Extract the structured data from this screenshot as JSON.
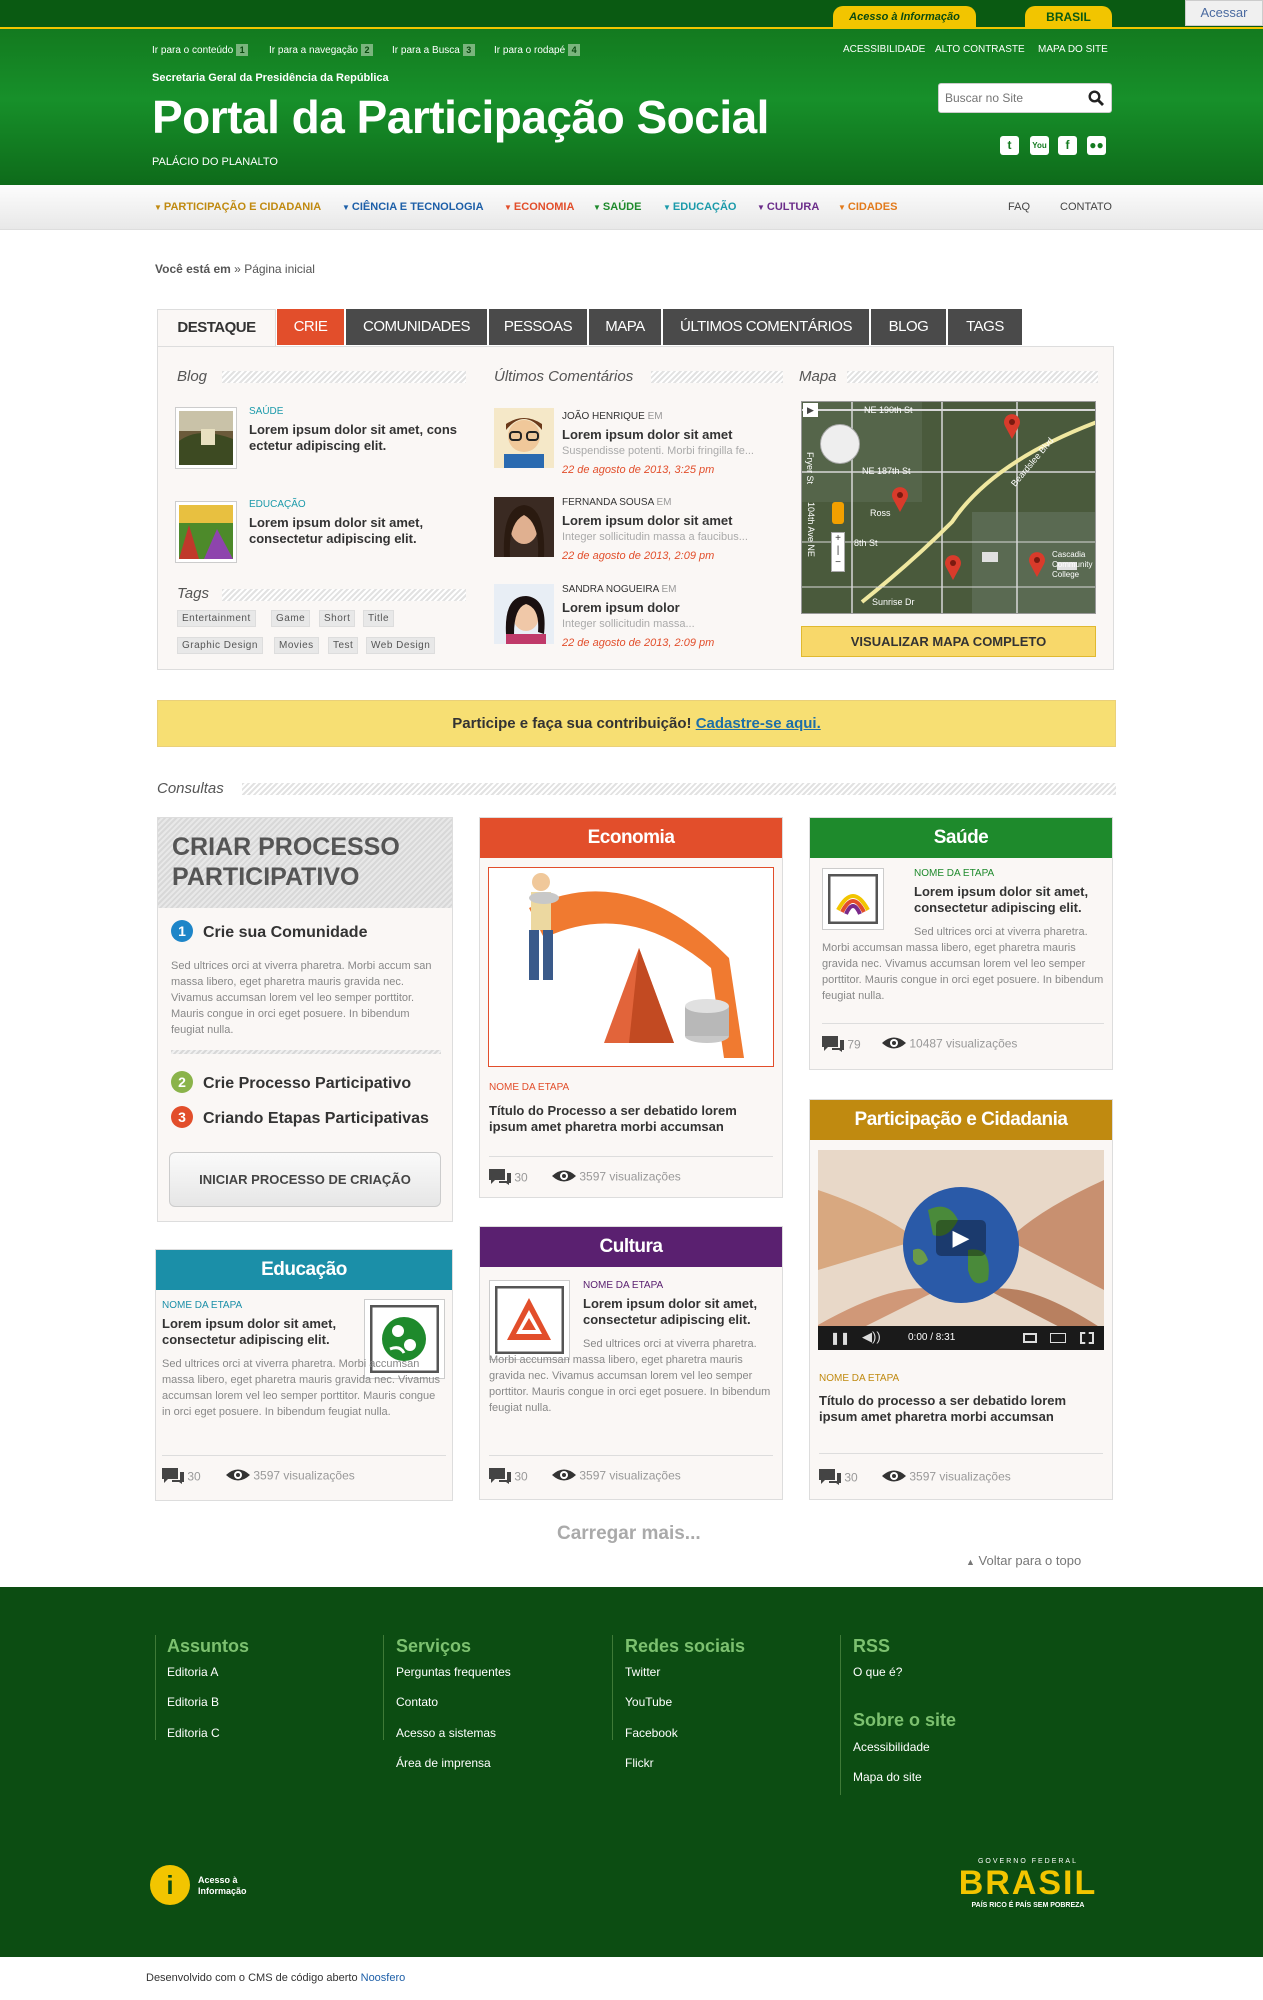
{
  "gov_bar": {
    "acesso_informacao": "Acesso à Informação",
    "brasil": "BRASIL",
    "acessar": "Acessar"
  },
  "header": {
    "skip_links": [
      {
        "label": "Ir para o conteúdo",
        "key": "1"
      },
      {
        "label": "Ir para a navegação",
        "key": "2"
      },
      {
        "label": "Ir para a Busca",
        "key": "3"
      },
      {
        "label": "Ir para o rodapé",
        "key": "4"
      }
    ],
    "top_links": [
      "ACESSIBILIDADE",
      "ALTO CONTRASTE",
      "MAPA DO SITE"
    ],
    "org": "Secretaria Geral da Presidência da República",
    "title": "Portal da Participação Social",
    "subtitle": "PALÁCIO DO PLANALTO",
    "search_placeholder": "Buscar no Site",
    "social_icons": [
      "twitter-icon",
      "youtube-icon",
      "facebook-icon",
      "flickr-icon"
    ]
  },
  "menu": {
    "items": [
      {
        "label": "PARTICIPAÇÃO E CIDADANIA",
        "color": "#c08a10"
      },
      {
        "label": "CIÊNCIA E TECNOLOGIA",
        "color": "#1d5fa8"
      },
      {
        "label": "ECONOMIA",
        "color": "#e24e2b"
      },
      {
        "label": "SAÚDE",
        "color": "#1e8a2c"
      },
      {
        "label": "EDUCAÇÃO",
        "color": "#1b9aaa"
      },
      {
        "label": "CULTURA",
        "color": "#6b2d8a"
      },
      {
        "label": "CIDADES",
        "color": "#e27a1b"
      }
    ],
    "right": [
      "FAQ",
      "CONTATO"
    ]
  },
  "breadcrumb": {
    "prefix": "Você está em",
    "sep": "»",
    "current": "Página inicial"
  },
  "tabs": [
    "DESTAQUE",
    "CRIE",
    "COMUNIDADES",
    "PESSOAS",
    "MAPA",
    "ÚLTIMOS COMENTÁRIOS",
    "BLOG",
    "TAGS"
  ],
  "destaque": {
    "blog_title": "Blog",
    "blog_posts": [
      {
        "category": "SAÚDE",
        "text": "Lorem ipsum dolor sit amet, cons ectetur adipiscing elit."
      },
      {
        "category": "EDUCAÇÃO",
        "text": "Lorem ipsum dolor sit amet, consectetur adipiscing elit."
      }
    ],
    "tags_title": "Tags",
    "tags": [
      "Entertainment",
      "Game",
      "Short",
      "Title",
      "Graphic Design",
      "Movies",
      "Test",
      "Web Design"
    ],
    "comments_title": "Últimos Comentários",
    "comments": [
      {
        "name": "JOÃO HENRIQUE",
        "em": "EM",
        "title": "Lorem ipsum dolor sit amet",
        "excerpt": "Suspendisse potenti. Morbi fringilla fe...",
        "date": "22 de agosto de 2013, 3:25 pm"
      },
      {
        "name": "FERNANDA SOUSA",
        "em": "EM",
        "title": "Lorem ipsum dolor sit amet",
        "excerpt": "Integer sollicitudin massa a faucibus...",
        "date": "22 de agosto de 2013, 2:09 pm"
      },
      {
        "name": "SANDRA NOGUEIRA",
        "em": "EM",
        "title": "Lorem ipsum dolor",
        "excerpt": "Integer sollicitudin massa...",
        "date": "22 de agosto de 2013, 2:09 pm"
      }
    ],
    "map_title": "Mapa",
    "map_labels": [
      "NE 190th St",
      "NE 187th St",
      "Fryer St",
      "104th Ave NE",
      "Beardslee Blvd",
      "Sunrise Dr",
      "Cascadia Community College",
      "Ross",
      "8th St"
    ],
    "map_button": "VISUALIZAR MAPA COMPLETO"
  },
  "banner": {
    "text": "Participe e faça sua contribuição!",
    "link": "Cadastre-se aqui."
  },
  "consultas": {
    "title": "Consultas",
    "criar": {
      "title_line1": "CRIAR PROCESSO",
      "title_line2": "PARTICIPATIVO",
      "step1": "Crie sua Comunidade",
      "step1_text": "Sed ultrices orci at viverra pharetra. Morbi accum san massa libero, eget pharetra mauris gravida nec. Vivamus accumsan lorem vel leo semper porttitor. Mauris congue in orci eget posuere. In bibendum feugiat nulla.",
      "step2": "Crie Processo Participativo",
      "step3": "Criando Etapas Participativas",
      "button": "INICIAR PROCESSO DE CRIAÇÃO",
      "numbers": [
        "1",
        "2",
        "3"
      ]
    },
    "economia": {
      "title": "Economia",
      "etapa": "NOME DA ETAPA",
      "text": "Título do Processo a ser debatido lorem ipsum amet pharetra morbi accumsan",
      "comments": "30",
      "views": "3597 visualizações"
    },
    "saude": {
      "title": "Saúde",
      "etapa": "NOME DA ETAPA",
      "heading": "Lorem ipsum dolor sit amet, consectetur adipiscing elit.",
      "text": "Sed ultrices orci at viverra pharetra. Morbi accumsan massa libero, eget pharetra mauris gravida nec. Vivamus accumsan lorem vel leo semper porttitor. Mauris congue in orci eget posuere. In bibendum feugiat nulla.",
      "comments": "79",
      "views": "10487 visualizações"
    },
    "participacao": {
      "title": "Participação e Cidadania",
      "etapa": "NOME DA ETAPA",
      "text": "Título do processo a ser debatido lorem ipsum amet pharetra morbi accumsan",
      "time": "0:00 / 8:31",
      "comments": "30",
      "views": "3597 visualizações"
    },
    "educacao": {
      "title": "Educação",
      "etapa": "NOME DA ETAPA",
      "heading": "Lorem ipsum dolor sit amet, consectetur adipiscing elit.",
      "text": "Sed ultrices orci at viverra pharetra. Morbi accumsan massa libero, eget pharetra mauris gravida nec. Vivamus accumsan lorem vel leo semper porttitor. Mauris congue in orci eget posuere. In bibendum feugiat nulla.",
      "comments": "30",
      "views": "3597 visualizações"
    },
    "cultura": {
      "title": "Cultura",
      "etapa": "NOME DA ETAPA",
      "heading": "Lorem ipsum dolor sit amet, consectetur adipiscing elit.",
      "text": "Sed ultrices orci at viverra pharetra. Morbi accumsan massa libero, eget pharetra mauris gravida nec. Vivamus accumsan lorem vel leo semper porttitor. Mauris congue in orci eget posuere. In bibendum feugiat nulla.",
      "comments": "30",
      "views": "3597 visualizações"
    },
    "load_more": "Carregar mais...",
    "back_to_top": "Voltar para o topo"
  },
  "footer": {
    "assuntos": {
      "title": "Assuntos",
      "links": [
        "Editoria A",
        "Editoria B",
        "Editoria C"
      ]
    },
    "servicos": {
      "title": "Serviços",
      "links": [
        "Perguntas frequentes",
        "Contato",
        "Acesso a sistemas",
        "Área de imprensa"
      ]
    },
    "redes": {
      "title": "Redes sociais",
      "links": [
        "Twitter",
        "YouTube",
        "Facebook",
        "Flickr"
      ]
    },
    "rss": {
      "title": "RSS",
      "links": [
        "O que é?"
      ]
    },
    "sobre": {
      "title": "Sobre o site",
      "links": [
        "Acessibilidade",
        "Mapa do site"
      ]
    },
    "acesso_logo": "Acesso à Informação",
    "gov_logo_top": "GOVERNO FEDERAL",
    "gov_logo": "BRASIL",
    "gov_logo_slogan": "PAÍS RICO É PAÍS SEM POBREZA"
  },
  "credits": {
    "text": "Desenvolvido com o CMS de código aberto",
    "link": "Noosfero"
  }
}
